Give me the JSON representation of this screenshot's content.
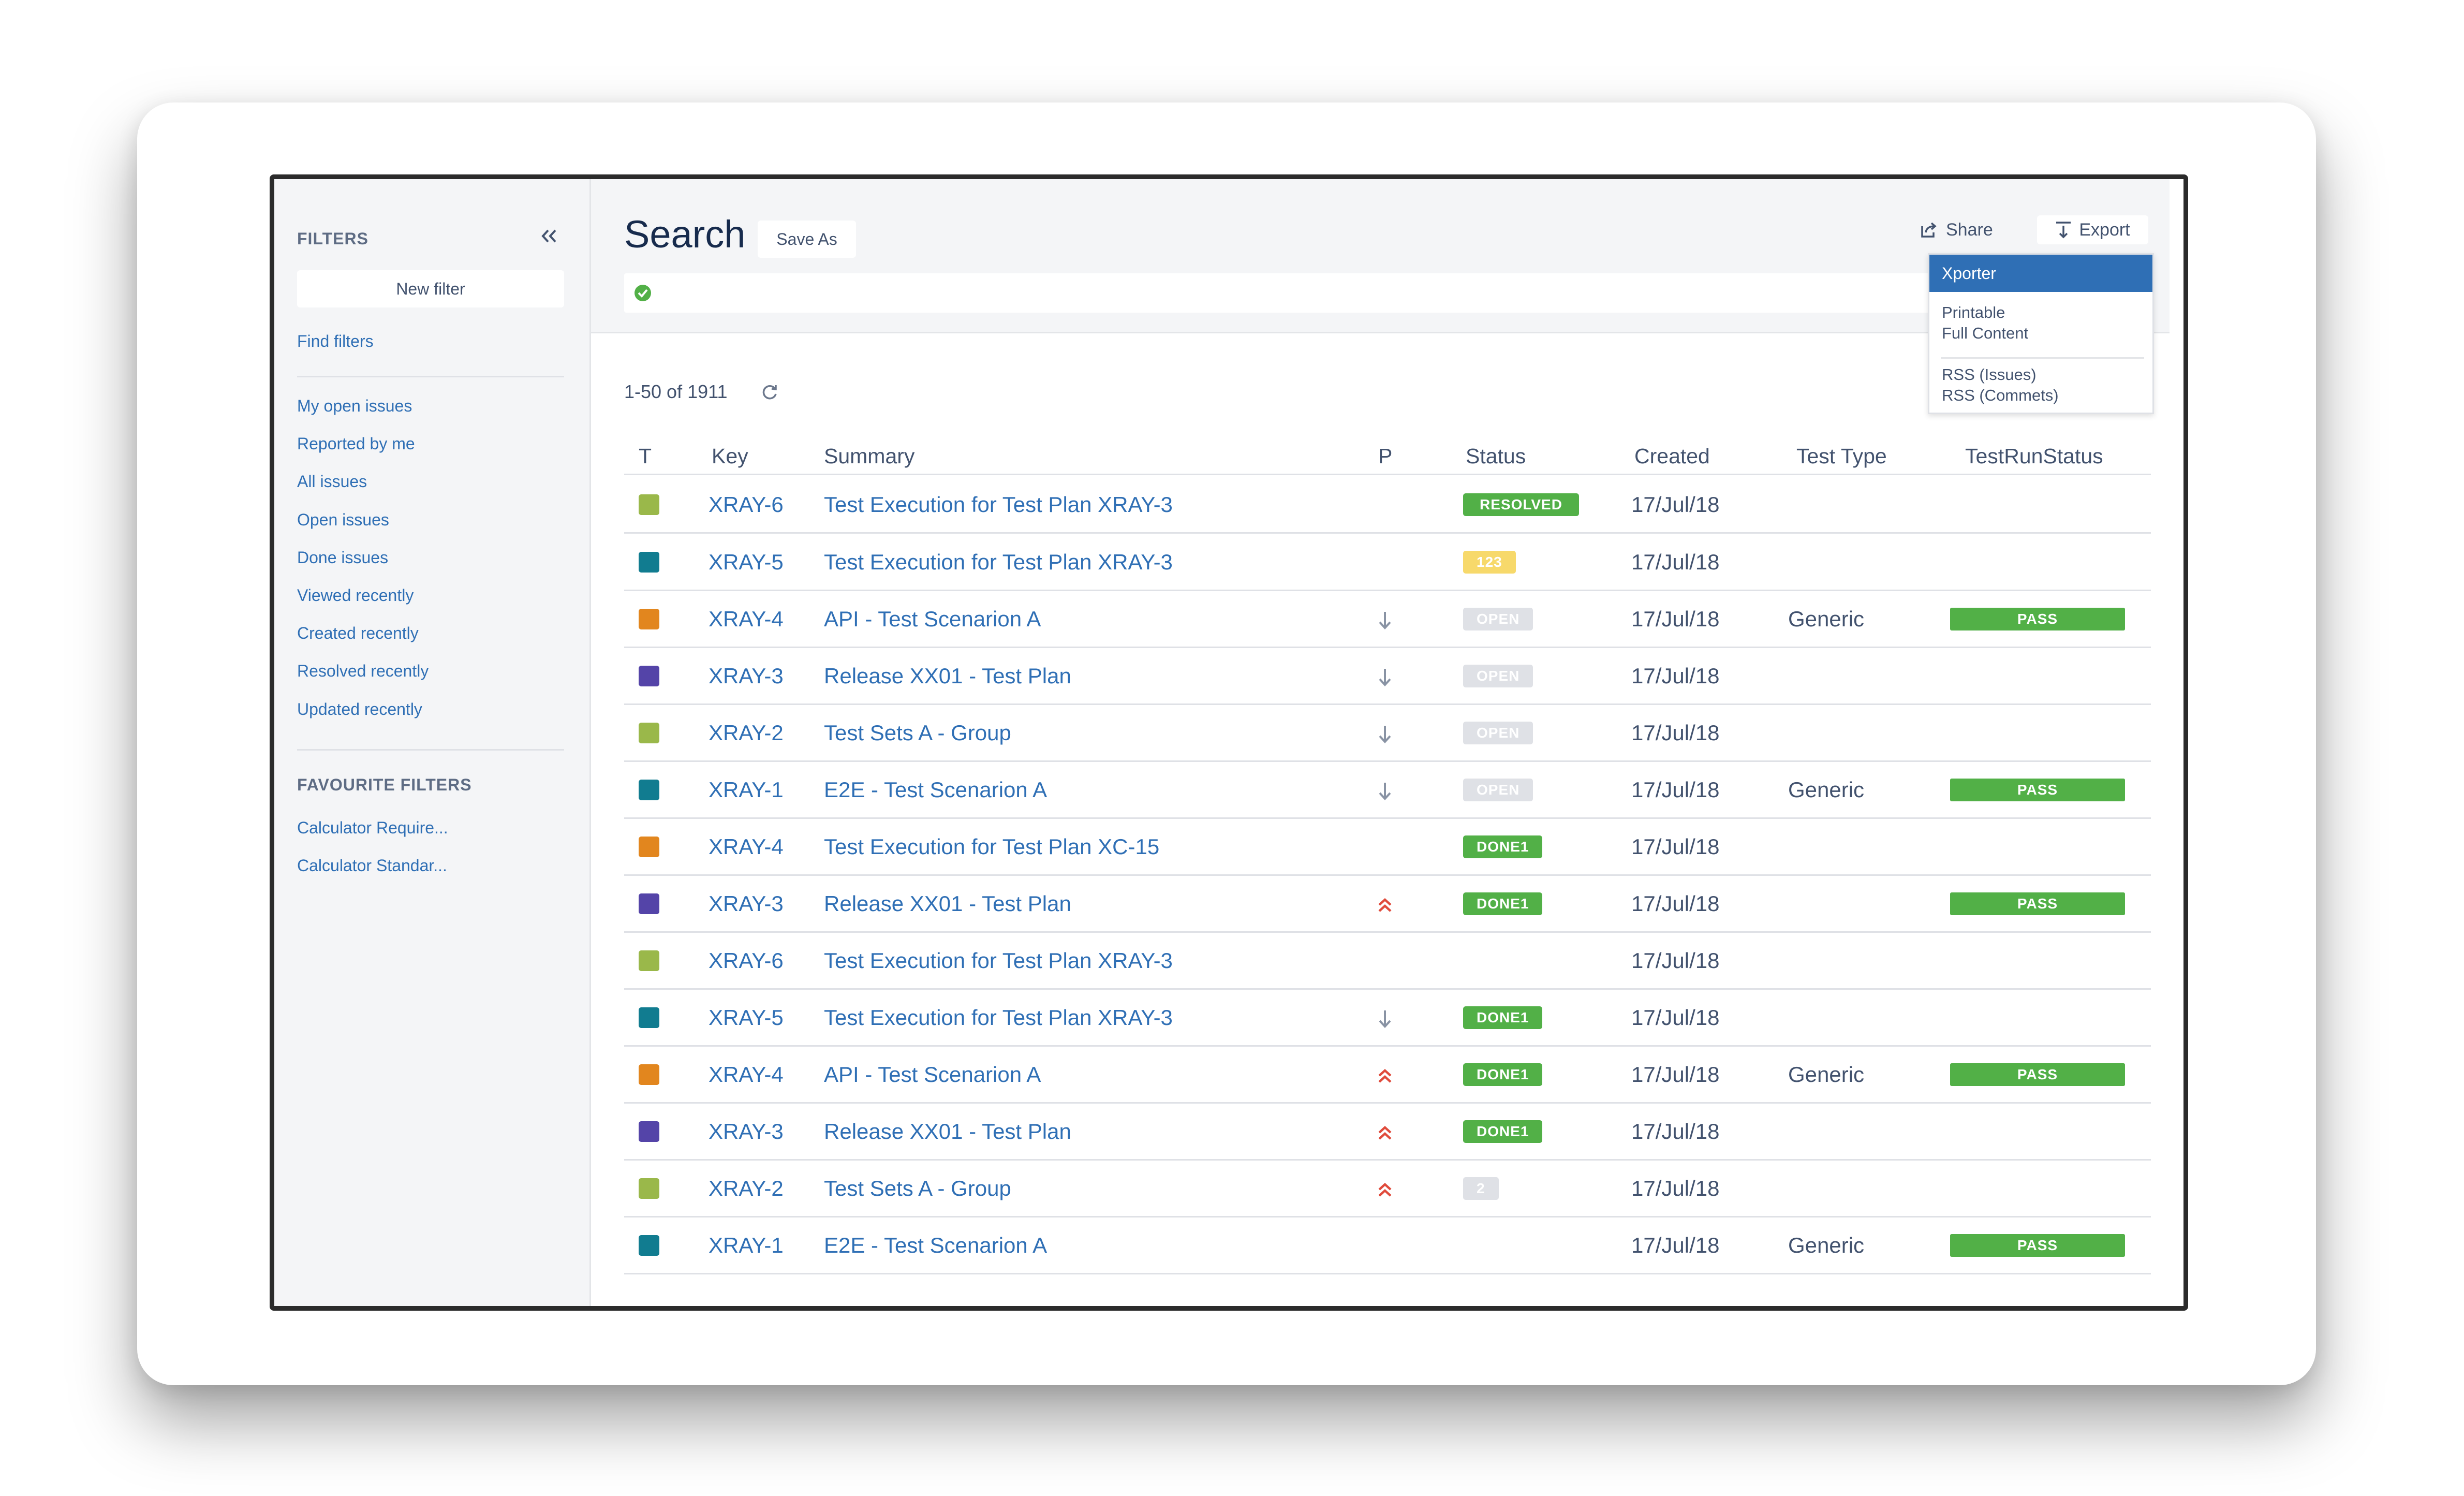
{
  "colors": {
    "link": "#2f6fb5",
    "resolved": "#52b047",
    "done": "#52b047",
    "open": "#dfe1e6",
    "yellow": "#f7d96b",
    "gray_badge": "#dfe1e6",
    "pass": "#52b047",
    "type_green": "#9ab84a",
    "type_teal": "#117c90",
    "type_orange": "#e2861e",
    "type_purple": "#5444a8",
    "prio_high": "#e04b3c",
    "prio_low": "#8993a4"
  },
  "sidebar": {
    "heading": "FILTERS",
    "collapse_icon": "double-chevron-left-icon",
    "new_filter": "New filter",
    "find_filters": "Find filters",
    "links": [
      "My open issues",
      "Reported by me",
      "All issues",
      "Open issues",
      "Done issues",
      "Viewed recently",
      "Created recently",
      "Resolved recently",
      "Updated recently"
    ],
    "favourites_heading": "FAVOURITE FILTERS",
    "favourites": [
      "Calculator Require...",
      "Calculator Standar..."
    ]
  },
  "header": {
    "title": "Search",
    "save_as": "Save As",
    "share": "Share",
    "export": "Export",
    "jql_status_icon": "check-circle-icon"
  },
  "export_menu": {
    "active": "Xporter",
    "group1": [
      "Printable",
      "Full Content"
    ],
    "group2": [
      "RSS (Issues)",
      "RSS (Commets)"
    ]
  },
  "results": {
    "count": "1-50 of 1911",
    "refresh_icon": "refresh-icon"
  },
  "columns": {
    "t": "T",
    "key": "Key",
    "summary": "Summary",
    "p": "P",
    "status": "Status",
    "created": "Created",
    "test_type": "Test Type",
    "test_run_status": "TestRunStatus"
  },
  "rows": [
    {
      "type": "green",
      "key": "XRAY-6",
      "summary": "Test Execution for Test Plan XRAY-3",
      "priority": "",
      "status": "RESOLVED",
      "status_style": "resolved",
      "created": "17/Jul/18",
      "test_type": "",
      "run": ""
    },
    {
      "type": "teal",
      "key": "XRAY-5",
      "summary": "Test Execution for Test Plan XRAY-3",
      "priority": "",
      "status": "123",
      "status_style": "yellow",
      "created": "17/Jul/18",
      "test_type": "",
      "run": ""
    },
    {
      "type": "orange",
      "key": "XRAY-4",
      "summary": "API - Test Scenarion A",
      "priority": "low",
      "status": "OPEN",
      "status_style": "open",
      "created": "17/Jul/18",
      "test_type": "Generic",
      "run": "PASS"
    },
    {
      "type": "purple",
      "key": "XRAY-3",
      "summary": "Release XX01 - Test Plan",
      "priority": "low",
      "status": "OPEN",
      "status_style": "open",
      "created": "17/Jul/18",
      "test_type": "",
      "run": ""
    },
    {
      "type": "green",
      "key": "XRAY-2",
      "summary": "Test Sets A - Group",
      "priority": "low",
      "status": "OPEN",
      "status_style": "open",
      "created": "17/Jul/18",
      "test_type": "",
      "run": ""
    },
    {
      "type": "teal",
      "key": "XRAY-1",
      "summary": "E2E - Test Scenarion A",
      "priority": "low",
      "status": "OPEN",
      "status_style": "open",
      "created": "17/Jul/18",
      "test_type": "Generic",
      "run": "PASS"
    },
    {
      "type": "orange",
      "key": "XRAY-4",
      "summary": "Test Execution for Test Plan XC-15",
      "priority": "",
      "status": "DONE1",
      "status_style": "done",
      "created": "17/Jul/18",
      "test_type": "",
      "run": ""
    },
    {
      "type": "purple",
      "key": "XRAY-3",
      "summary": "Release XX01 - Test Plan",
      "priority": "high",
      "status": "DONE1",
      "status_style": "done",
      "created": "17/Jul/18",
      "test_type": "",
      "run": "PASS"
    },
    {
      "type": "green",
      "key": "XRAY-6",
      "summary": "Test Execution for Test Plan XRAY-3",
      "priority": "",
      "status": "",
      "status_style": "",
      "created": "17/Jul/18",
      "test_type": "",
      "run": ""
    },
    {
      "type": "teal",
      "key": "XRAY-5",
      "summary": "Test Execution for Test Plan XRAY-3",
      "priority": "low",
      "status": "DONE1",
      "status_style": "done",
      "created": "17/Jul/18",
      "test_type": "",
      "run": ""
    },
    {
      "type": "orange",
      "key": "XRAY-4",
      "summary": "API - Test Scenarion A",
      "priority": "high",
      "status": "DONE1",
      "status_style": "done",
      "created": "17/Jul/18",
      "test_type": "Generic",
      "run": "PASS"
    },
    {
      "type": "purple",
      "key": "XRAY-3",
      "summary": "Release XX01 - Test Plan",
      "priority": "high",
      "status": "DONE1",
      "status_style": "done",
      "created": "17/Jul/18",
      "test_type": "",
      "run": ""
    },
    {
      "type": "green",
      "key": "XRAY-2",
      "summary": "Test Sets A - Group",
      "priority": "high",
      "status": "2",
      "status_style": "gray",
      "created": "17/Jul/18",
      "test_type": "",
      "run": ""
    },
    {
      "type": "teal",
      "key": "XRAY-1",
      "summary": "E2E - Test Scenarion A",
      "priority": "",
      "status": "",
      "status_style": "",
      "created": "17/Jul/18",
      "test_type": "Generic",
      "run": "PASS"
    }
  ]
}
